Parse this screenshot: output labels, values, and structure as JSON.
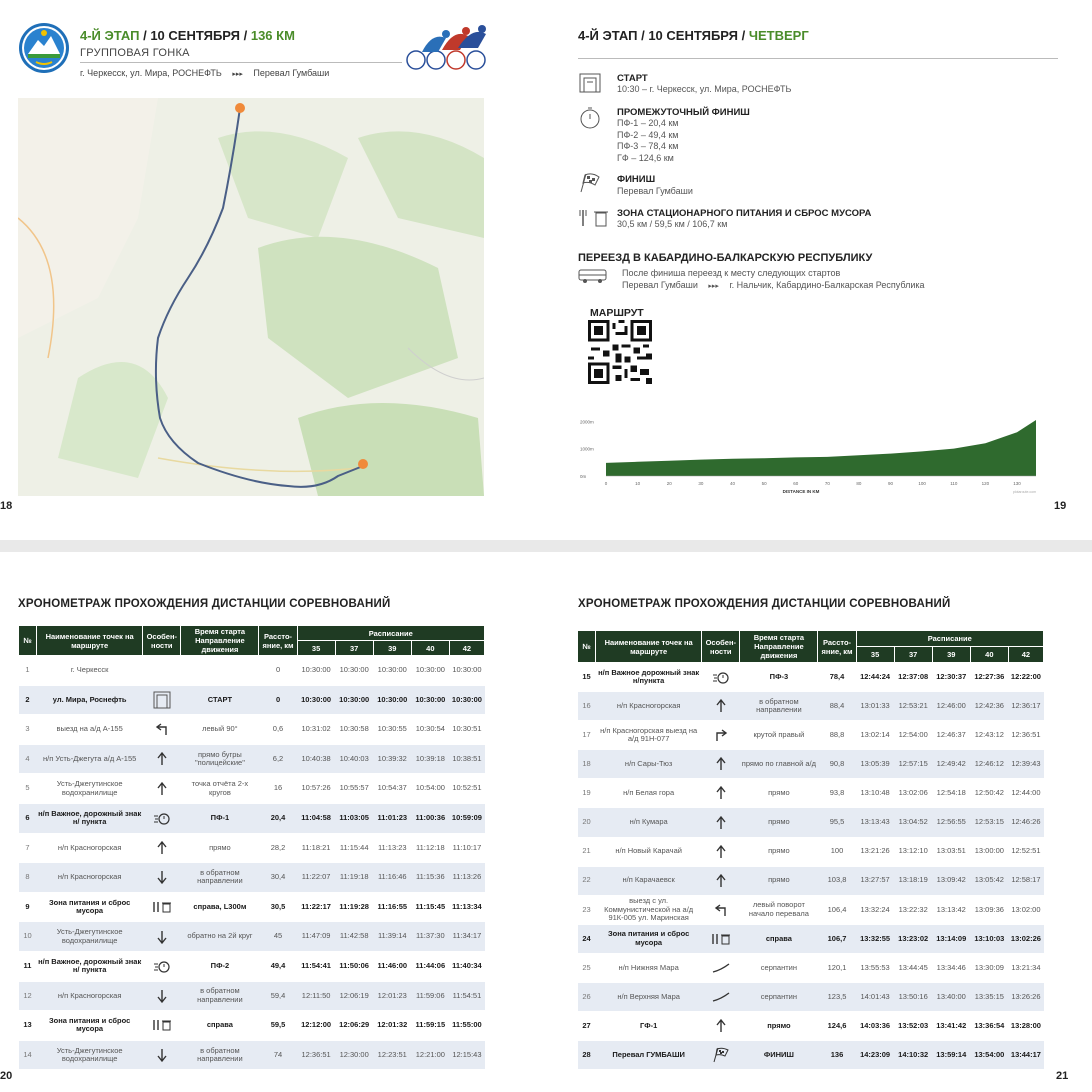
{
  "page18": {
    "page_number": "18",
    "stage_label": "4-Й ЭТАП",
    "date_label": "10 СЕНТЯБРЯ",
    "distance_label": "136 КМ",
    "race_type": "ГРУППОВАЯ ГОНКА",
    "route_from": "г. Черкесск, ул. Мира, РОСНЕФТЬ",
    "route_arrows": "▸▸▸",
    "route_to": "Перевал Гумбаши"
  },
  "page19": {
    "page_number": "19",
    "stage_label": "4-Й ЭТАП",
    "date_label": "10 СЕНТЯБРЯ",
    "weekday_label": "ЧЕТВЕРГ",
    "start_title": "СТАРТ",
    "start_value": "10:30 – г. Черкесск, ул. Мира, РОСНЕФТЬ",
    "intermediate_title": "ПРОМЕЖУТОЧНЫЙ ФИНИШ",
    "intermediate_lines": [
      "ПФ-1 –  20,4 км",
      "ПФ-2 –  49,4 км",
      "ПФ-3 –  78,4 км",
      "ГФ     –  124,6 км"
    ],
    "finish_title": "ФИНИШ",
    "finish_value": "Перевал Гумбаши",
    "feed_title": "ЗОНА СТАЦИОНАРНОГО ПИТАНИЯ И СБРОС МУСОРА",
    "feed_value": "30,5 км / 59,5 км / 106,7 км",
    "transfer_title": "ПЕРЕЕЗД В КАБАРДИНО-БАЛКАРСКУЮ РЕСПУБЛИКУ",
    "transfer_line1": "После финиша переезд к месту следующих стартов",
    "transfer_from": "Перевал Гумбаши",
    "transfer_arrows": "▸▸▸",
    "transfer_to": "г. Нальчик, Кабардино-Балкарская Республика",
    "route_label": "МАРШРУТ",
    "elevation": {
      "y_ticks": [
        "2000m",
        "1000m",
        "0m"
      ],
      "x_ticks": [
        "0",
        "10",
        "20",
        "30",
        "40",
        "50",
        "60",
        "70",
        "80",
        "90",
        "100",
        "110",
        "120",
        "130"
      ],
      "x_label": "DISTANCE IN KM",
      "credit": "plotaroute.com",
      "profile_km": [
        0,
        10,
        20,
        30,
        40,
        50,
        60,
        70,
        80,
        90,
        100,
        110,
        120,
        130,
        136
      ],
      "profile_m": [
        480,
        520,
        560,
        600,
        630,
        650,
        680,
        700,
        760,
        820,
        900,
        1000,
        1200,
        1600,
        2050
      ]
    }
  },
  "colors": {
    "header_green": "#1f3b23",
    "accent_green": "#4a8c2a",
    "row_alt": "#e6ebf3"
  },
  "table_title": "ХРОНОМЕТРАЖ ПРОХОЖДЕНИЯ ДИСТАНЦИИ СОРЕВНОВАНИЙ",
  "table_headers": {
    "no": "№",
    "name": "Наименование точек на маршруте",
    "feat": "Особен-ности",
    "time": "Время старта Направление движения",
    "dist": "Рассто-яние, км",
    "schedule": "Расписание",
    "speeds": [
      "35",
      "37",
      "39",
      "40",
      "42"
    ]
  },
  "page20": {
    "page_number": "20",
    "rows": [
      {
        "no": "1",
        "name": "г. Черкесск",
        "icon": "",
        "dir": "",
        "dist": "0",
        "t": [
          "10:30:00",
          "10:30:00",
          "10:30:00",
          "10:30:00",
          "10:30:00"
        ],
        "bold": false
      },
      {
        "no": "2",
        "name": "ул. Мира, Роснефть",
        "icon": "start",
        "dir": "СТАРТ",
        "dist": "0",
        "t": [
          "10:30:00",
          "10:30:00",
          "10:30:00",
          "10:30:00",
          "10:30:00"
        ],
        "bold": true
      },
      {
        "no": "3",
        "name": "выезд на а/д А-155",
        "icon": "left",
        "dir": "левый 90°",
        "dist": "0,6",
        "t": [
          "10:31:02",
          "10:30:58",
          "10:30:55",
          "10:30:54",
          "10:30:51"
        ],
        "bold": false
      },
      {
        "no": "4",
        "name": "н/п Усть-Джегута а/д А-155",
        "icon": "up",
        "dir": "прямо бугры \"полицейские\"",
        "dist": "6,2",
        "t": [
          "10:40:38",
          "10:40:03",
          "10:39:32",
          "10:39:18",
          "10:38:51"
        ],
        "bold": false
      },
      {
        "no": "5",
        "name": "Усть-Джегутинское водохранилище",
        "icon": "up",
        "dir": "точка отчёта 2-х кругов",
        "dist": "16",
        "t": [
          "10:57:26",
          "10:55:57",
          "10:54:37",
          "10:54:00",
          "10:52:51"
        ],
        "bold": false
      },
      {
        "no": "6",
        "name": "н/п Важное, дорожный знак н/ пункта",
        "icon": "sprint",
        "dir": "ПФ-1",
        "dist": "20,4",
        "t": [
          "11:04:58",
          "11:03:05",
          "11:01:23",
          "11:00:36",
          "10:59:09"
        ],
        "bold": true
      },
      {
        "no": "7",
        "name": "н/п Красногорская",
        "icon": "up",
        "dir": "прямо",
        "dist": "28,2",
        "t": [
          "11:18:21",
          "11:15:44",
          "11:13:23",
          "11:12:18",
          "11:10:17"
        ],
        "bold": false
      },
      {
        "no": "8",
        "name": "н/п Красногорская",
        "icon": "down",
        "dir": "в обратном направлении",
        "dist": "30,4",
        "t": [
          "11:22:07",
          "11:19:18",
          "11:16:46",
          "11:15:36",
          "11:13:26"
        ],
        "bold": false
      },
      {
        "no": "9",
        "name": "Зона питания и сброс мусора",
        "icon": "feed",
        "dir": "справа, L300м",
        "dist": "30,5",
        "t": [
          "11:22:17",
          "11:19:28",
          "11:16:55",
          "11:15:45",
          "11:13:34"
        ],
        "bold": true
      },
      {
        "no": "10",
        "name": "Усть-Джегутинское водохранилище",
        "icon": "down",
        "dir": "обратно на 2й круг",
        "dist": "45",
        "t": [
          "11:47:09",
          "11:42:58",
          "11:39:14",
          "11:37:30",
          "11:34:17"
        ],
        "bold": false
      },
      {
        "no": "11",
        "name": "н/п Важное, дорожный знак н/ пункта",
        "icon": "sprint",
        "dir": "ПФ-2",
        "dist": "49,4",
        "t": [
          "11:54:41",
          "11:50:06",
          "11:46:00",
          "11:44:06",
          "11:40:34"
        ],
        "bold": true
      },
      {
        "no": "12",
        "name": "н/п Красногорская",
        "icon": "down",
        "dir": "в обратном направлении",
        "dist": "59,4",
        "t": [
          "12:11:50",
          "12:06:19",
          "12:01:23",
          "11:59:06",
          "11:54:51"
        ],
        "bold": false
      },
      {
        "no": "13",
        "name": "Зона питания и сброс мусора",
        "icon": "feed",
        "dir": "справа",
        "dist": "59,5",
        "t": [
          "12:12:00",
          "12:06:29",
          "12:01:32",
          "11:59:15",
          "11:55:00"
        ],
        "bold": true
      },
      {
        "no": "14",
        "name": "Усть-Джегутинское водохранилище",
        "icon": "down",
        "dir": "в обратном направлении",
        "dist": "74",
        "t": [
          "12:36:51",
          "12:30:00",
          "12:23:51",
          "12:21:00",
          "12:15:43"
        ],
        "bold": false
      }
    ]
  },
  "page21": {
    "page_number": "21",
    "rows": [
      {
        "no": "15",
        "name": "н/п Важное дорожный знак н/пункта",
        "icon": "sprint",
        "dir": "ПФ-3",
        "dist": "78,4",
        "t": [
          "12:44:24",
          "12:37:08",
          "12:30:37",
          "12:27:36",
          "12:22:00"
        ],
        "bold": true
      },
      {
        "no": "16",
        "name": "н/п Красногорская",
        "icon": "up",
        "dir": "в обратном направлении",
        "dist": "88,4",
        "t": [
          "13:01:33",
          "12:53:21",
          "12:46:00",
          "12:42:36",
          "12:36:17"
        ],
        "bold": false
      },
      {
        "no": "17",
        "name": "н/п Красногорская выезд на а/д 91Н-077",
        "icon": "right",
        "dir": "крутой правый",
        "dist": "88,8",
        "t": [
          "13:02:14",
          "12:54:00",
          "12:46:37",
          "12:43:12",
          "12:36:51"
        ],
        "bold": false
      },
      {
        "no": "18",
        "name": "н/п Сары-Тюз",
        "icon": "up",
        "dir": "прямо по главной а/д",
        "dist": "90,8",
        "t": [
          "13:05:39",
          "12:57:15",
          "12:49:42",
          "12:46:12",
          "12:39:43"
        ],
        "bold": false
      },
      {
        "no": "19",
        "name": "н/п Белая гора",
        "icon": "up",
        "dir": "прямо",
        "dist": "93,8",
        "t": [
          "13:10:48",
          "13:02:06",
          "12:54:18",
          "12:50:42",
          "12:44:00"
        ],
        "bold": false
      },
      {
        "no": "20",
        "name": "н/п Кумара",
        "icon": "up",
        "dir": "прямо",
        "dist": "95,5",
        "t": [
          "13:13:43",
          "13:04:52",
          "12:56:55",
          "12:53:15",
          "12:46:26"
        ],
        "bold": false
      },
      {
        "no": "21",
        "name": "н/п Новый Карачай",
        "icon": "up",
        "dir": "прямо",
        "dist": "100",
        "t": [
          "13:21:26",
          "13:12:10",
          "13:03:51",
          "13:00:00",
          "12:52:51"
        ],
        "bold": false
      },
      {
        "no": "22",
        "name": "н/п Карачаевск",
        "icon": "up",
        "dir": "прямо",
        "dist": "103,8",
        "t": [
          "13:27:57",
          "13:18:19",
          "13:09:42",
          "13:05:42",
          "12:58:17"
        ],
        "bold": false
      },
      {
        "no": "23",
        "name": "выезд с ул. Коммунистической на а/д 91К-005 ул. Маринская",
        "icon": "left",
        "dir": "левый поворот начало перевала",
        "dist": "106,4",
        "t": [
          "13:32:24",
          "13:22:32",
          "13:13:42",
          "13:09:36",
          "13:02:00"
        ],
        "bold": false
      },
      {
        "no": "24",
        "name": "Зона питания и сброс мусора",
        "icon": "feed",
        "dir": "справа",
        "dist": "106,7",
        "t": [
          "13:32:55",
          "13:23:02",
          "13:14:09",
          "13:10:03",
          "13:02:26"
        ],
        "bold": true
      },
      {
        "no": "25",
        "name": "н/п Нижняя Мара",
        "icon": "climb",
        "dir": "серпантин",
        "dist": "120,1",
        "t": [
          "13:55:53",
          "13:44:45",
          "13:34:46",
          "13:30:09",
          "13:21:34"
        ],
        "bold": false
      },
      {
        "no": "26",
        "name": "н/п Верхняя Мара",
        "icon": "climb",
        "dir": "серпантин",
        "dist": "123,5",
        "t": [
          "14:01:43",
          "13:50:16",
          "13:40:00",
          "13:35:15",
          "13:26:26"
        ],
        "bold": false
      },
      {
        "no": "27",
        "name": "ГФ-1",
        "icon": "up",
        "dir": "прямо",
        "dist": "124,6",
        "t": [
          "14:03:36",
          "13:52:03",
          "13:41:42",
          "13:36:54",
          "13:28:00"
        ],
        "bold": true
      },
      {
        "no": "28",
        "name": "Перевал ГУМБАШИ",
        "icon": "flag",
        "dir": "ФИНИШ",
        "dist": "136",
        "t": [
          "14:23:09",
          "14:10:32",
          "13:59:14",
          "13:54:00",
          "13:44:17"
        ],
        "bold": true
      }
    ]
  }
}
